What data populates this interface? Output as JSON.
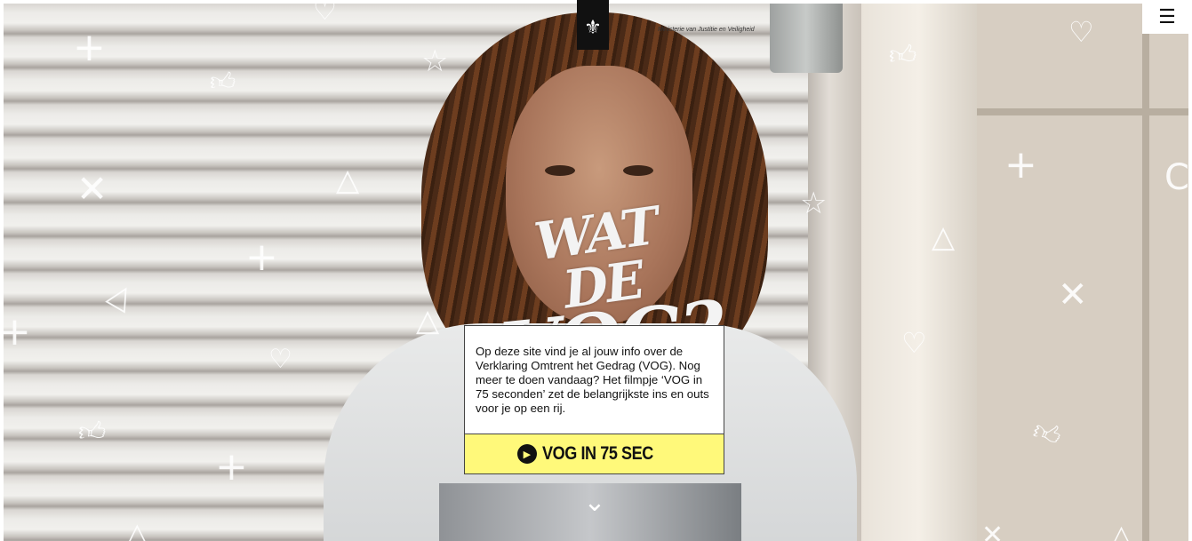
{
  "header": {
    "logo_icon": "coat-of-arms-icon",
    "ministry_label": "Ministerie van Justitie en Veiligheid",
    "menu_icon": "hamburger-menu-icon"
  },
  "hero": {
    "title_line1": "WAT DE",
    "title_line2": "VOG?"
  },
  "card": {
    "text": "Op deze site vind je al jouw info over de Verklaring Omtrent het Gedrag (VOG). Nog meer te doen vandaag? Het filmpje ‘VOG in 75 seconden’ zet de belangrijkste ins en outs voor je op een rij.",
    "cta_label": "VOG IN 75 SEC",
    "cta_color": "#fff97a"
  },
  "scroll_icon": "chevron-down-icon"
}
